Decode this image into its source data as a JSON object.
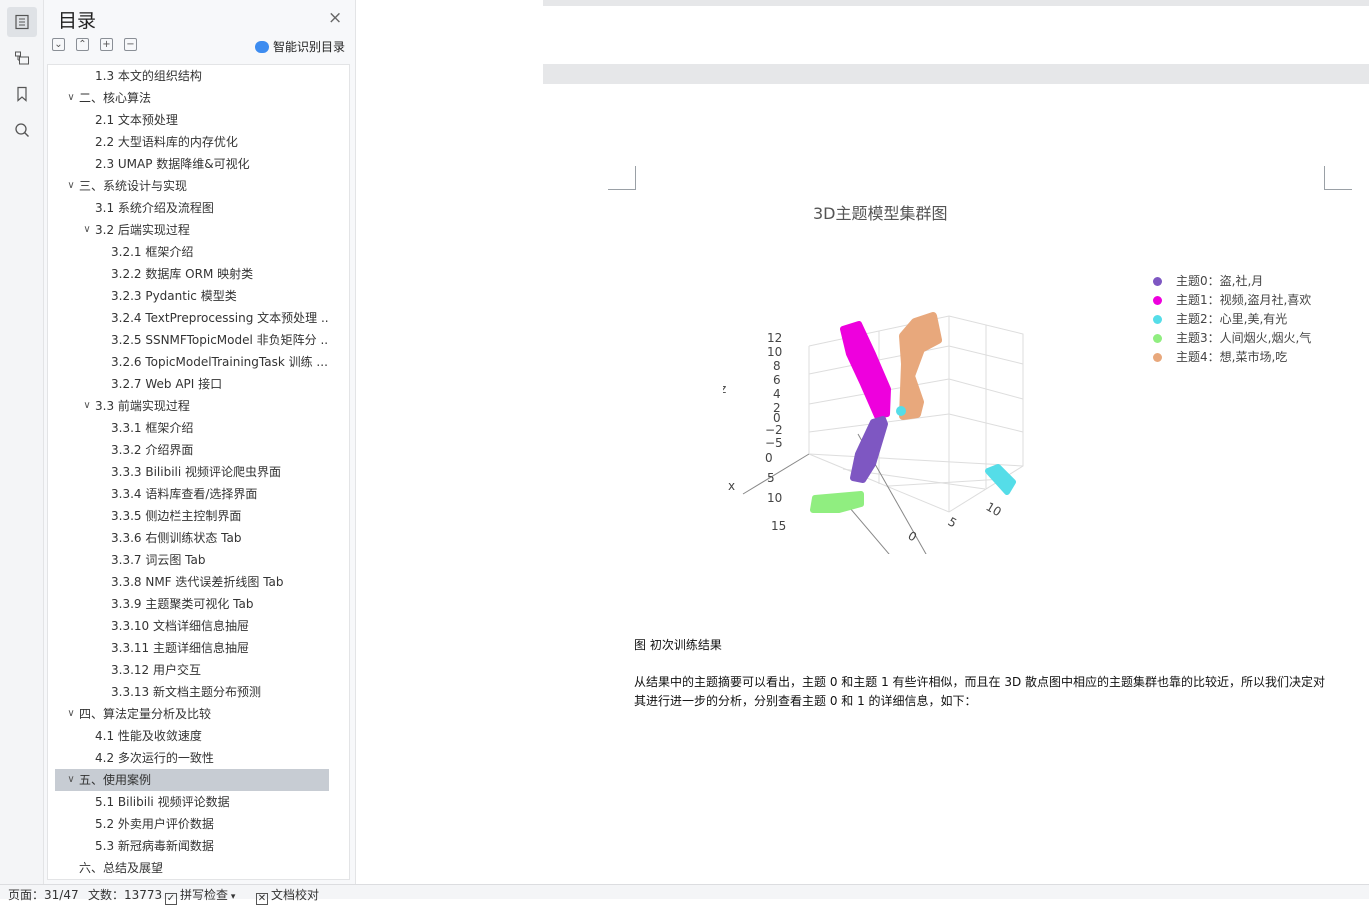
{
  "toc": {
    "title": "目录",
    "close": "×",
    "smart_toc": "智能识别目录",
    "items": [
      {
        "label": "1.3 本文的组织结构",
        "level": 2,
        "chevron": ""
      },
      {
        "label": "二、核心算法",
        "level": 1,
        "chevron": "∨"
      },
      {
        "label": "2.1 文本预处理",
        "level": 2,
        "chevron": ""
      },
      {
        "label": "2.2 大型语料库的内存优化",
        "level": 2,
        "chevron": ""
      },
      {
        "label": "2.3 UMAP 数据降维&可视化",
        "level": 2,
        "chevron": ""
      },
      {
        "label": "三、系统设计与实现",
        "level": 1,
        "chevron": "∨"
      },
      {
        "label": "3.1 系统介绍及流程图",
        "level": 2,
        "chevron": ""
      },
      {
        "label": "3.2 后端实现过程",
        "level": 2,
        "chevron": "∨"
      },
      {
        "label": "3.2.1 框架介绍",
        "level": 3,
        "chevron": ""
      },
      {
        "label": "3.2.2 数据库 ORM 映射类",
        "level": 3,
        "chevron": ""
      },
      {
        "label": "3.2.3 Pydantic 模型类",
        "level": 3,
        "chevron": ""
      },
      {
        "label": "3.2.4 TextPreprocessing 文本预处理 ...",
        "level": 3,
        "chevron": ""
      },
      {
        "label": "3.2.5 SSNMFTopicModel 非负矩阵分 ...",
        "level": 3,
        "chevron": ""
      },
      {
        "label": "3.2.6 TopicModelTrainingTask 训练 ...",
        "level": 3,
        "chevron": ""
      },
      {
        "label": "3.2.7 Web API 接口",
        "level": 3,
        "chevron": ""
      },
      {
        "label": "3.3 前端实现过程",
        "level": 2,
        "chevron": "∨"
      },
      {
        "label": "3.3.1 框架介绍",
        "level": 3,
        "chevron": ""
      },
      {
        "label": "3.3.2 介绍界面",
        "level": 3,
        "chevron": ""
      },
      {
        "label": "3.3.3 Bilibili 视频评论爬虫界面",
        "level": 3,
        "chevron": ""
      },
      {
        "label": "3.3.4 语料库查看/选择界面",
        "level": 3,
        "chevron": ""
      },
      {
        "label": "3.3.5 侧边栏主控制界面",
        "level": 3,
        "chevron": ""
      },
      {
        "label": "3.3.6 右侧训练状态 Tab",
        "level": 3,
        "chevron": ""
      },
      {
        "label": "3.3.7 词云图 Tab",
        "level": 3,
        "chevron": ""
      },
      {
        "label": "3.3.8 NMF 迭代误差折线图 Tab",
        "level": 3,
        "chevron": ""
      },
      {
        "label": "3.3.9 主题聚类可视化 Tab",
        "level": 3,
        "chevron": ""
      },
      {
        "label": "3.3.10 文档详细信息抽屉",
        "level": 3,
        "chevron": ""
      },
      {
        "label": "3.3.11 主题详细信息抽屉",
        "level": 3,
        "chevron": ""
      },
      {
        "label": "3.3.12 用户交互",
        "level": 3,
        "chevron": ""
      },
      {
        "label": "3.3.13 新文档主题分布预测",
        "level": 3,
        "chevron": ""
      },
      {
        "label": "四、算法定量分析及比较",
        "level": 1,
        "chevron": "∨"
      },
      {
        "label": "4.1 性能及收敛速度",
        "level": 2,
        "chevron": ""
      },
      {
        "label": "4.2 多次运行的一致性",
        "level": 2,
        "chevron": ""
      },
      {
        "label": "五、使用案例",
        "level": 1,
        "chevron": "∨",
        "selected": true
      },
      {
        "label": "5.1 Bilibili 视频评论数据",
        "level": 2,
        "chevron": ""
      },
      {
        "label": "5.2 外卖用户评价数据",
        "level": 2,
        "chevron": ""
      },
      {
        "label": "5.3 新冠病毒新闻数据",
        "level": 2,
        "chevron": ""
      },
      {
        "label": "六、总结及展望",
        "level": 1,
        "chevron": ""
      }
    ]
  },
  "chart_data": {
    "type": "scatter",
    "title": "3D主题模型集群图",
    "legend_position": "top-right",
    "series": [
      {
        "name": "主题0：盗,社,月",
        "color": "#7e57c2"
      },
      {
        "name": "主题1：视频,盗月社,喜欢",
        "color": "#ee00dd"
      },
      {
        "name": "主题2：心里,美,有光",
        "color": "#55dde8"
      },
      {
        "name": "主题3：人间烟火,烟火,气",
        "color": "#90ee80"
      },
      {
        "name": "主题4：想,菜市场,吃",
        "color": "#e8a87c"
      }
    ],
    "axes": {
      "z": {
        "label": "z",
        "ticks": [
          "12",
          "10",
          "8",
          "6",
          "4",
          "2",
          "0",
          "−2",
          "−5"
        ]
      },
      "x": {
        "label": "x",
        "ticks": [
          "0",
          "5",
          "10",
          "15"
        ]
      },
      "y": {
        "label": "",
        "ticks": [
          "0",
          "5",
          "10"
        ]
      }
    }
  },
  "document": {
    "caption": "图 初次训练结果",
    "paragraph": "从结果中的主题摘要可以看出，主题 0 和主题 1 有些许相似，而且在 3D 散点图中相应的主题集群也靠的比较近，所以我们决定对其进行进一步的分析，分别查看主题 0 和 1 的详细信息，如下："
  },
  "status": {
    "page": "页面：31/47",
    "words": "文数：13773",
    "spell_check": "拼写检查",
    "doc_check": "文档校对"
  }
}
